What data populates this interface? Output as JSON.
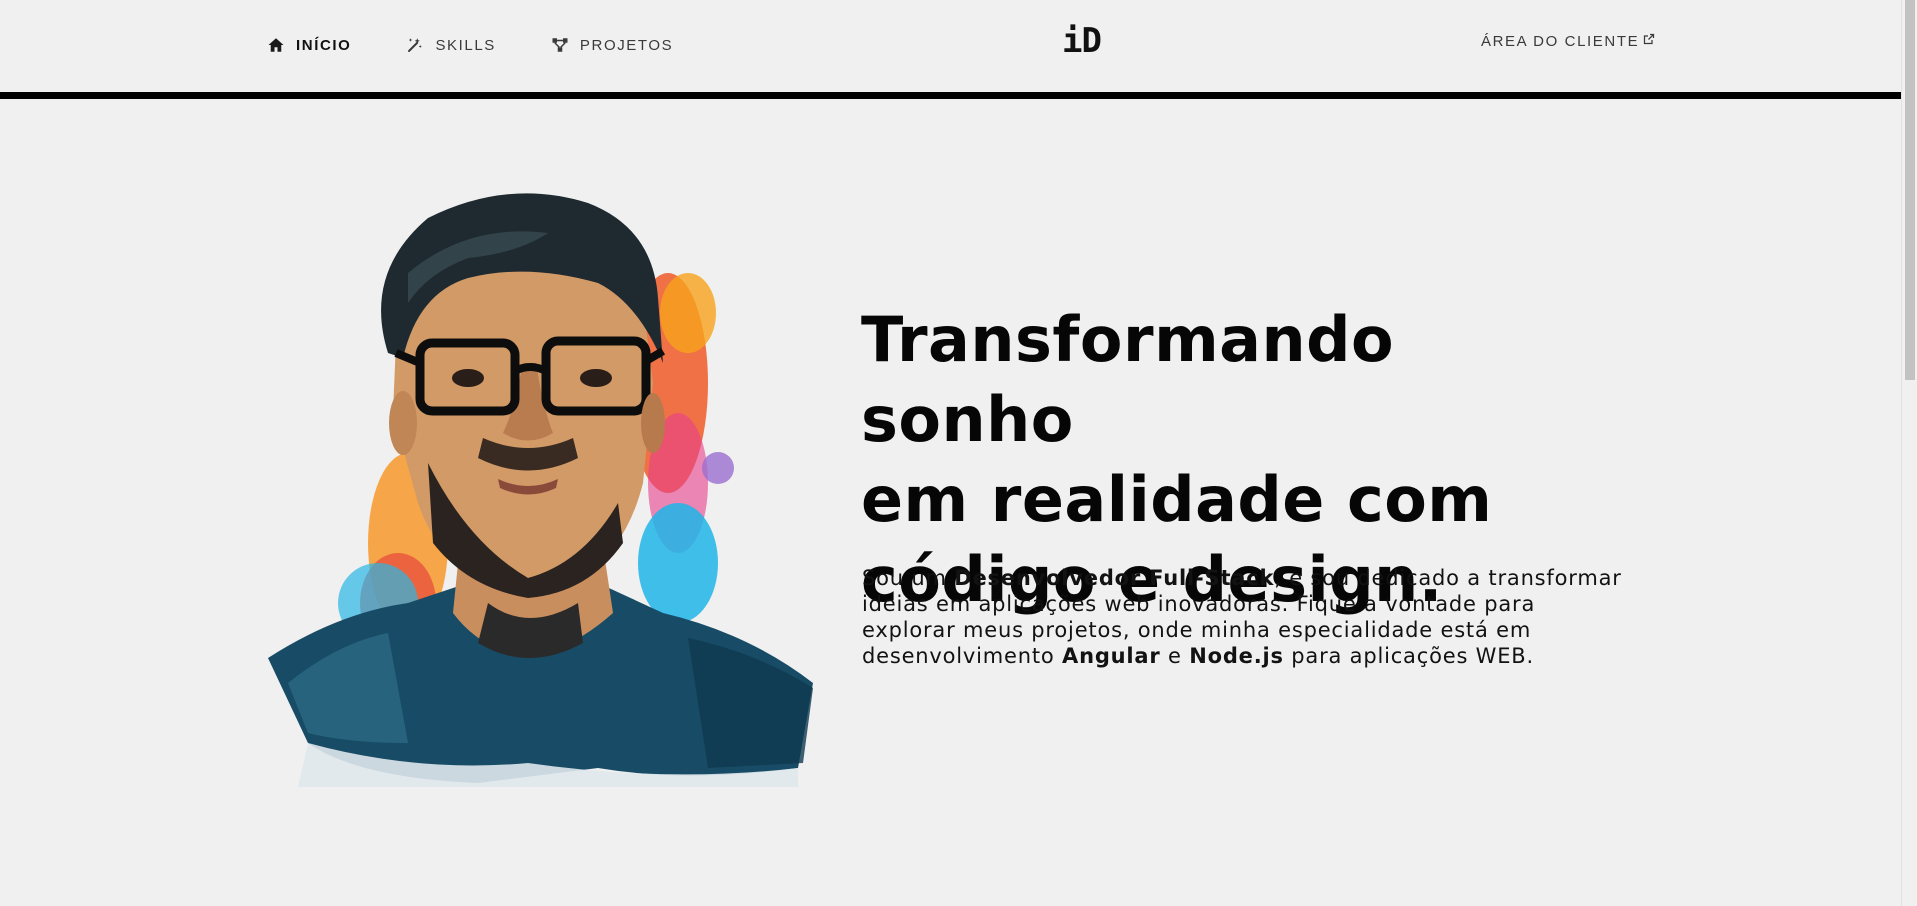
{
  "nav": {
    "items": [
      {
        "label": "INÍCIO",
        "icon": "home-icon",
        "active": true
      },
      {
        "label": "SKILLS",
        "icon": "magic-wand-icon",
        "active": false
      },
      {
        "label": "PROJETOS",
        "icon": "network-icon",
        "active": false
      }
    ],
    "client_area": "ÁREA DO CLIENTE",
    "client_icon": "external-link-icon"
  },
  "logo": "iD",
  "hero": {
    "title_lines": [
      "Transformando sonho",
      "em realidade com",
      "código e design."
    ],
    "description": {
      "p1": "Sou um ",
      "b1": "Desenvolvedor Full-Stack",
      "p2": ", e sou dedicado a transformar ideias em aplicações web inovadoras. Fique a vontade para explorar meus projetos, onde minha especialidade está em desenvolvimento ",
      "b2": "Angular",
      "p3": " e ",
      "b3": "Node.js",
      "p4": " para aplicações WEB."
    }
  },
  "colors": {
    "background": "#f0f0f0",
    "text": "#0a0a0a",
    "header_bar": "#000000"
  }
}
